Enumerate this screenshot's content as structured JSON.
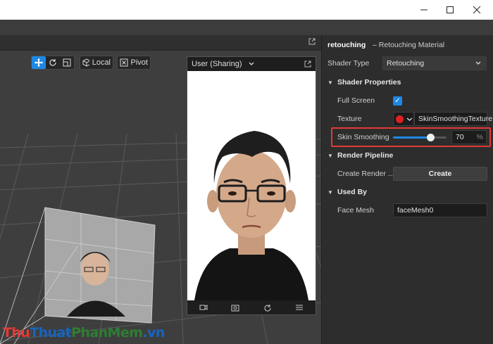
{
  "window": {
    "minimize_icon": "minimize-icon",
    "maximize_icon": "maximize-icon",
    "close_icon": "close-icon"
  },
  "viewport": {
    "toolbar": {
      "local_label": "Local",
      "pivot_label": "Pivot"
    }
  },
  "preview": {
    "camera_label": "User (Sharing)",
    "footer_icons": [
      "video-icon",
      "camera-switch-icon",
      "rotate-icon",
      "menu-icon"
    ]
  },
  "inspector": {
    "object_name": "retouching",
    "object_subtitle": "– Retouching Material",
    "shader_type_label": "Shader Type",
    "shader_type_value": "Retouching",
    "shader_properties_label": "Shader Properties",
    "full_screen_label": "Full Screen",
    "full_screen_checked": true,
    "texture_label": "Texture",
    "texture_color": "#e02020",
    "texture_value": "SkinSmoothingTexture",
    "skin_smoothing_label": "Skin Smoothing",
    "skin_smoothing_value": "70",
    "skin_smoothing_unit": "%",
    "skin_smoothing_fraction": 0.7,
    "render_pipeline_label": "Render Pipeline",
    "create_render_label": "Create Render ...",
    "create_button_label": "Create",
    "used_by_label": "Used By",
    "face_mesh_label": "Face Mesh",
    "face_mesh_value": "faceMesh0"
  },
  "watermark": {
    "part1": "Thu",
    "part2": "Thuat",
    "part3": "PhanMem",
    "part4": ".vn"
  },
  "colors": {
    "accent": "#1e88e5",
    "highlight": "#e53935"
  }
}
